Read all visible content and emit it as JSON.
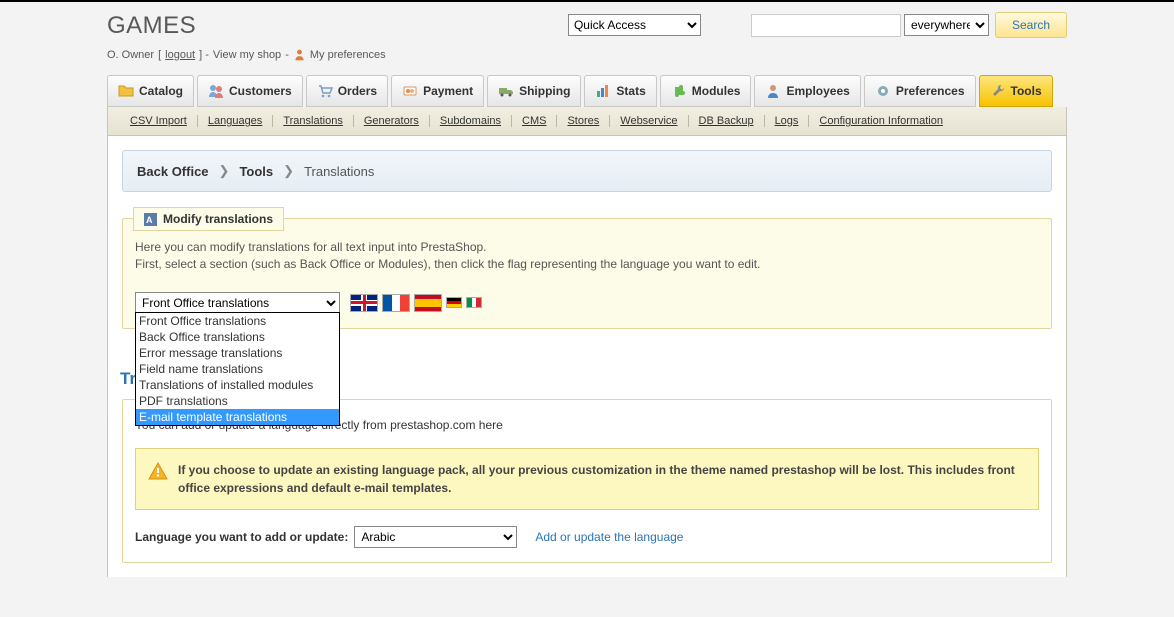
{
  "site_title": "GAMES",
  "owner_line": {
    "owner": "O. Owner",
    "logout": "logout",
    "view_shop": "View my shop",
    "prefs": "My preferences"
  },
  "quick_access": {
    "label": "Quick Access"
  },
  "search": {
    "placeholder": "",
    "scope": "everywhere",
    "button": "Search"
  },
  "main_tabs": {
    "catalog": "Catalog",
    "customers": "Customers",
    "orders": "Orders",
    "payment": "Payment",
    "shipping": "Shipping",
    "stats": "Stats",
    "modules": "Modules",
    "employees": "Employees",
    "preferences": "Preferences",
    "tools": "Tools"
  },
  "subnav": [
    "CSV Import",
    "Languages",
    "Translations",
    "Generators",
    "Subdomains",
    "CMS",
    "Stores",
    "Webservice",
    "DB Backup",
    "Logs",
    "Configuration Information"
  ],
  "breadcrumb": {
    "a": "Back Office",
    "b": "Tools",
    "c": "Translations"
  },
  "modify_panel": {
    "legend": "Modify translations",
    "desc1": "Here you can modify translations for all text input into PrestaShop.",
    "desc2": "First, select a section (such as Back Office or Modules), then click the flag representing the language you want to edit.",
    "selected": "Front Office translations",
    "options": [
      "Front Office translations",
      "Back Office translations",
      "Error message translations",
      "Field name translations",
      "Translations of installed modules",
      "PDF translations",
      "E-mail template translations"
    ],
    "highlighted_index": 6
  },
  "partial_heading": "Tr",
  "add_panel": {
    "desc": "You can add or update a language directly from prestashop.com here",
    "warning": "If you choose to update an existing language pack, all your previous customization in the theme named prestashop will be lost. This includes front office expressions and default e-mail templates.",
    "label": "Language you want to add or update:",
    "selected_lang": "Arabic",
    "action": "Add or update the language"
  }
}
